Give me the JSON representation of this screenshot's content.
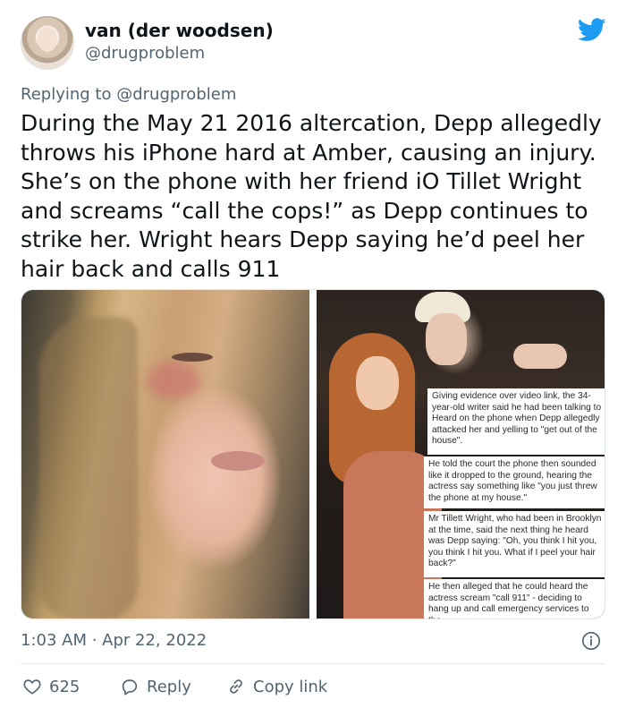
{
  "author": {
    "display_name": "van (der woodsen)",
    "handle": "@drugproblem"
  },
  "reply_context": {
    "prefix": "Replying to",
    "mention": "@drugproblem"
  },
  "tweet": {
    "text": "During the May 21 2016 altercation, Depp allegedly throws his iPhone hard at Amber, causing an injury. She’s on the phone with her friend iO Tillet Wright and screams “call the cops!” as Depp continues to strike her. Wright hears Depp saying he’d peel her hair back and calls 911"
  },
  "media": {
    "captions": [
      "Giving evidence over video link, the 34-year-old writer said he had been talking to Heard on the phone when Depp allegedly attacked her and yelling to \"get out of the house\".",
      "He told the court the phone then sounded like it dropped to the ground, hearing the actress say something like \"you just threw the phone at my house.\"",
      "Mr Tillett Wright, who had been in Brooklyn at the time, said the next thing he heard was Depp saying: \"Oh, you think I hit you, you think I hit you. What if I peel your hair back?\"",
      "He then alleged that he could heard the actress scream \"call 911\" - deciding to hang up and call emergency services to the"
    ]
  },
  "meta": {
    "timestamp": "1:03 AM · Apr 22, 2022"
  },
  "actions": {
    "likes": "625",
    "reply_label": "Reply",
    "copy_label": "Copy link"
  },
  "icons": {
    "brand": "twitter-bird-icon",
    "brand_color": "#1d9bf0",
    "info": "info-icon",
    "like": "heart-icon",
    "reply": "speech-bubble-icon",
    "copy": "link-icon"
  },
  "colors": {
    "text_primary": "#0f1419",
    "text_secondary": "#536471",
    "divider": "#e1e8ed"
  }
}
